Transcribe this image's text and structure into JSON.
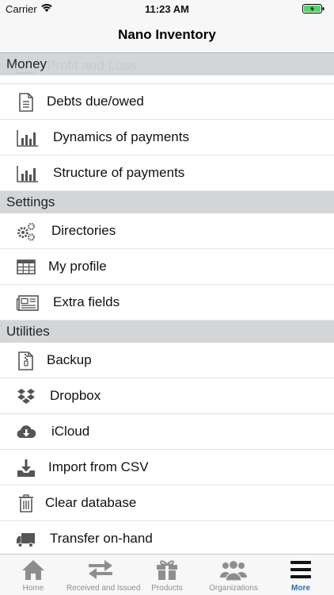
{
  "status": {
    "carrier": "Carrier",
    "time": "11:23 AM"
  },
  "nav": {
    "title": "Nano Inventory"
  },
  "ghost": {
    "label": "Profit and Loss"
  },
  "sections": {
    "money": {
      "title": "Money",
      "items": [
        {
          "label": "Debts due/owed",
          "icon": "document-icon"
        },
        {
          "label": "Dynamics of payments",
          "icon": "bar-chart-icon"
        },
        {
          "label": "Structure of payments",
          "icon": "bar-chart-icon"
        }
      ]
    },
    "settings": {
      "title": "Settings",
      "items": [
        {
          "label": "Directories",
          "icon": "gears-icon"
        },
        {
          "label": "My profile",
          "icon": "table-icon"
        },
        {
          "label": "Extra fields",
          "icon": "newspaper-icon"
        }
      ]
    },
    "utilities": {
      "title": "Utilities",
      "items": [
        {
          "label": "Backup",
          "icon": "zip-file-icon"
        },
        {
          "label": "Dropbox",
          "icon": "dropbox-icon"
        },
        {
          "label": "iCloud",
          "icon": "cloud-download-icon"
        },
        {
          "label": "Import from CSV",
          "icon": "import-icon"
        },
        {
          "label": "Clear database",
          "icon": "trash-icon"
        },
        {
          "label": "Transfer on-hand",
          "icon": "truck-icon"
        }
      ]
    }
  },
  "tabs": [
    {
      "label": "Home",
      "icon": "home-icon"
    },
    {
      "label": "Received and Issued",
      "icon": "arrows-icon"
    },
    {
      "label": "Products",
      "icon": "gift-icon"
    },
    {
      "label": "Organizations",
      "icon": "users-icon"
    },
    {
      "label": "More",
      "icon": "menu-icon",
      "active": true
    }
  ],
  "colors": {
    "accent": "#1a6fc4",
    "section_bg": "#d3d6d9",
    "icon": "#555555"
  }
}
